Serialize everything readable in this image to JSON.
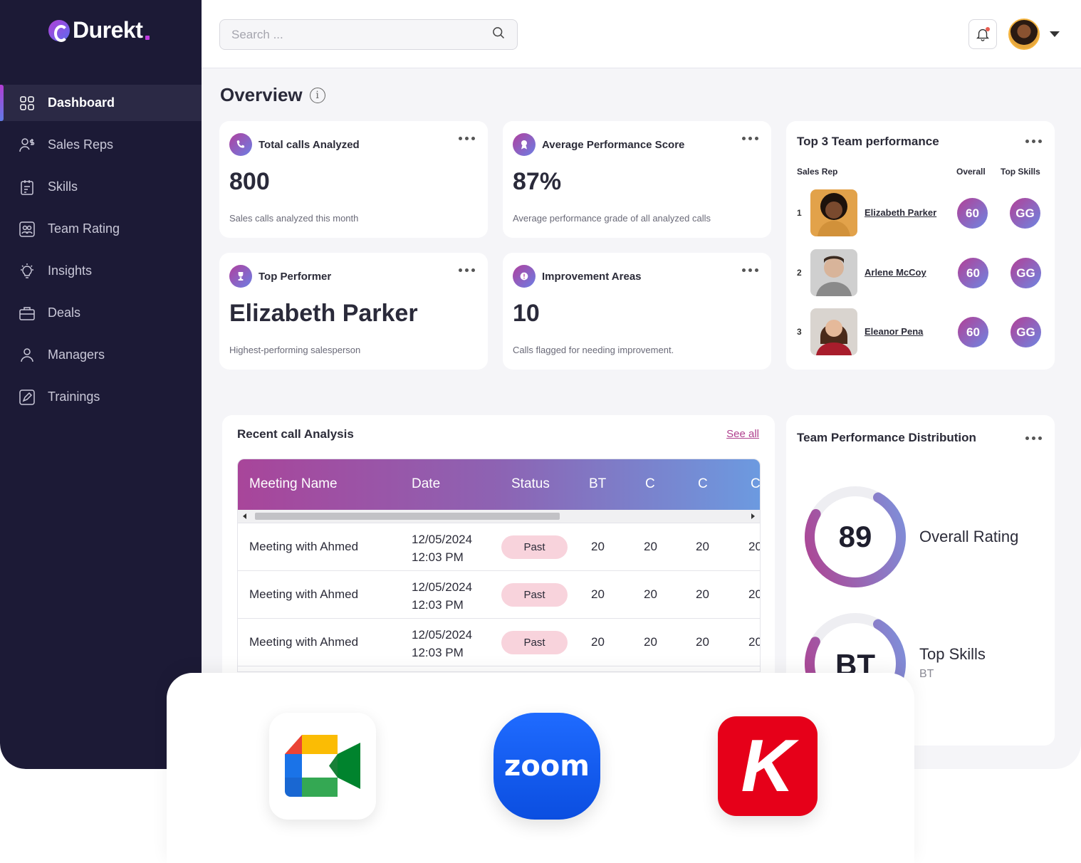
{
  "brand": {
    "name": "Durekt"
  },
  "sidebar": {
    "items": [
      {
        "label": "Dashboard",
        "icon": "grid-icon",
        "active": true
      },
      {
        "label": "Sales Reps",
        "icon": "users-dollar-icon",
        "active": false
      },
      {
        "label": "Skills",
        "icon": "clipboard-icon",
        "active": false
      },
      {
        "label": "Team Rating",
        "icon": "team-rating-icon",
        "active": false
      },
      {
        "label": "Insights",
        "icon": "lightbulb-icon",
        "active": false
      },
      {
        "label": "Deals",
        "icon": "briefcase-icon",
        "active": false
      },
      {
        "label": "Managers",
        "icon": "user-icon",
        "active": false
      },
      {
        "label": "Trainings",
        "icon": "pen-icon",
        "active": false
      }
    ]
  },
  "header": {
    "search_placeholder": "Search ..."
  },
  "overview": {
    "title": "Overview",
    "cards": [
      {
        "title": "Total calls Analyzed",
        "value": "800",
        "sub": "Sales calls analyzed this month",
        "icon": "phone-icon"
      },
      {
        "title": "Average Performance Score",
        "value": "87%",
        "sub": "Average performance grade of all analyzed calls",
        "icon": "award-icon"
      },
      {
        "title": "Top Performer",
        "value": "Elizabeth Parker",
        "sub": "Highest-performing salesperson",
        "icon": "trophy-icon"
      },
      {
        "title": "Improvement Areas",
        "value": "10",
        "sub": "Calls flagged for needing improvement.",
        "icon": "alert-icon"
      }
    ]
  },
  "top3": {
    "title": "Top 3 Team performance",
    "col_rep": "Sales Rep",
    "col_overall": "Overall",
    "col_skills": "Top Skills",
    "reps": [
      {
        "rank": "1",
        "name": "Elizabeth Parker",
        "overall": "60",
        "skills": "GG"
      },
      {
        "rank": "2",
        "name": "Arlene McCoy",
        "overall": "60",
        "skills": "GG"
      },
      {
        "rank": "3",
        "name": "Eleanor Pena",
        "overall": "60",
        "skills": "GG"
      }
    ]
  },
  "recent": {
    "title": "Recent call Analysis",
    "see_all": "See all",
    "columns": [
      "Meeting Name",
      "Date",
      "Status",
      "BT",
      "C",
      "C",
      "C"
    ],
    "rows": [
      {
        "name": "Meeting with Ahmed",
        "date": "12/05/2024",
        "time": "12:03 PM",
        "status": "Past",
        "v1": "20",
        "v2": "20",
        "v3": "20",
        "v4": "20"
      },
      {
        "name": "Meeting with Ahmed",
        "date": "12/05/2024",
        "time": "12:03 PM",
        "status": "Past",
        "v1": "20",
        "v2": "20",
        "v3": "20",
        "v4": "20"
      },
      {
        "name": "Meeting with Ahmed",
        "date": "12/05/2024",
        "time": "12:03 PM",
        "status": "Past",
        "v1": "20",
        "v2": "20",
        "v3": "20",
        "v4": "20"
      }
    ]
  },
  "distribution": {
    "title": "Team Performance Distribution",
    "overall_value": "89",
    "overall_label": "Overall Rating",
    "overall_fraction": 0.75,
    "skills_value": "BT",
    "skills_label": "Top Skills",
    "skills_sub": "BT"
  },
  "integrations": [
    {
      "name": "Google Meet",
      "icon": "google-meet-icon"
    },
    {
      "name": "zoom",
      "icon": "zoom-icon"
    },
    {
      "name": "K",
      "icon": "kaltura-icon"
    }
  ],
  "colors": {
    "sidebar": "#1c1a36",
    "accent_start": "#b0409e",
    "accent_end": "#6c7fe4",
    "status_past": "#f8d3dc"
  }
}
